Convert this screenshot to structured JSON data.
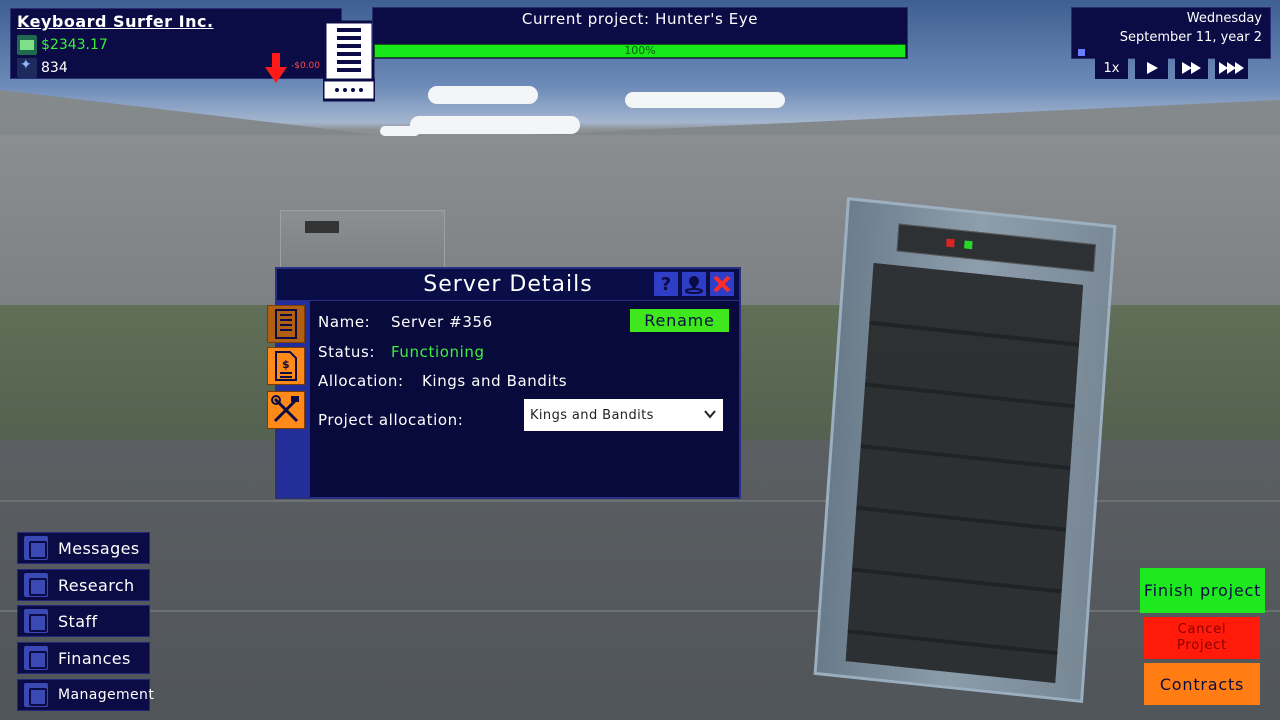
{
  "company": {
    "name": "Keyboard Surfer Inc.",
    "money": "$2343.17",
    "reputation": "834",
    "money_change": "-$0.00",
    "money_icon": "money-icon",
    "reputation_icon": "reputation-icon"
  },
  "project": {
    "title": "Current project: Hunter's Eye",
    "progress_label": "100%",
    "progress": 1.0
  },
  "date": {
    "weekday": "Wednesday",
    "date": "September 11, year 2"
  },
  "speed": {
    "current": "1x",
    "buttons": [
      "play-icon",
      "fast-forward-icon",
      "fastest-forward-icon"
    ]
  },
  "dialog": {
    "title": "Server Details",
    "help": "?",
    "name_label": "Name:",
    "name_value": "Server #356",
    "rename": "Rename",
    "status_label": "Status:",
    "status_value": "Functioning",
    "allocation_label": "Allocation:",
    "allocation_value": "Kings and Bandits",
    "project_allocation_label": "Project allocation:",
    "project_allocation_selected": "Kings and Bandits"
  },
  "menu": {
    "messages": "Messages",
    "research": "Research",
    "staff": "Staff",
    "finances": "Finances",
    "management": "Management"
  },
  "actions": {
    "finish": "Finish project",
    "cancel": "Cancel Project",
    "contracts": "Contracts"
  },
  "colors": {
    "panel": "#0b0c45",
    "accent_green": "#18e81b",
    "status_green": "#3cf03c",
    "cancel_red": "#ff1a0a",
    "contracts_orange": "#ff7d12",
    "tab_orange": "#ff8a1a"
  }
}
